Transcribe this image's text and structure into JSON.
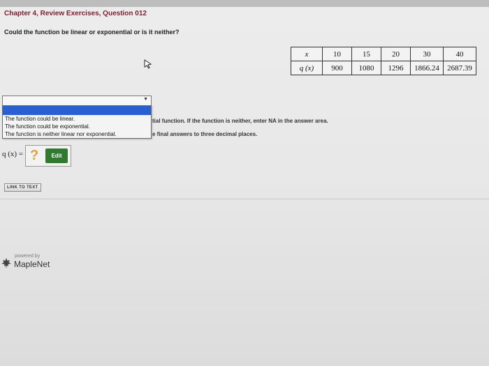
{
  "header": {
    "title": "Chapter 4, Review Exercises, Question 012",
    "question": "Could the function be linear or exponential or is it neither?"
  },
  "table": {
    "row_x_label": "x",
    "row_q_label": "q (x)",
    "x_values": [
      "10",
      "15",
      "20",
      "30",
      "40"
    ],
    "q_values": [
      "900",
      "1080",
      "1296",
      "1866.24",
      "2687.39"
    ]
  },
  "dropdown": {
    "selected": "",
    "options": [
      "The function could be linear.",
      "The function could be exponential.",
      "The function is neither linear nor exponential."
    ]
  },
  "instructions": {
    "line1": "tial function. If the function is neither, enter NA in the answer area.",
    "line2": "e final answers to three decimal places."
  },
  "answer": {
    "label": "q (x) =",
    "placeholder": "?",
    "edit_label": "Edit"
  },
  "link_text": "LINK TO TEXT",
  "footer": {
    "powered_by": "powered by",
    "brand": "MapleNet"
  }
}
